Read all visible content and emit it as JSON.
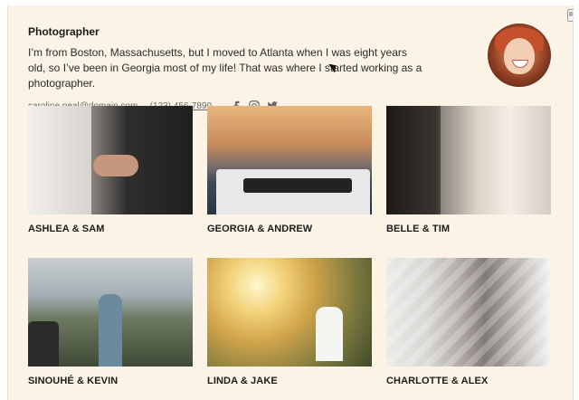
{
  "profile": {
    "title": "Photographer",
    "bio": "I’m from Boston, Massachusetts, but I moved to Atlanta when I was eight years old, so I’ve been in Georgia most of my life! That was where I started working as a photographer.",
    "email": "caroline.peal@domain.com",
    "separator": "·",
    "phone": "(123) 456-7890",
    "socials": [
      "facebook-icon",
      "instagram-icon",
      "twitter-icon"
    ]
  },
  "gallery": [
    {
      "name": "ASHLEA & SAM"
    },
    {
      "name": "GEORGIA & ANDREW"
    },
    {
      "name": "BELLE & TIM"
    },
    {
      "name": "SINOUHÉ & KEVIN"
    },
    {
      "name": "LINDA & JAKE"
    },
    {
      "name": "CHARLOTTE & ALEX"
    }
  ],
  "colors": {
    "page_bg": "#fbf4e6",
    "text": "#1f1f1f",
    "muted": "#6b6b6b"
  }
}
